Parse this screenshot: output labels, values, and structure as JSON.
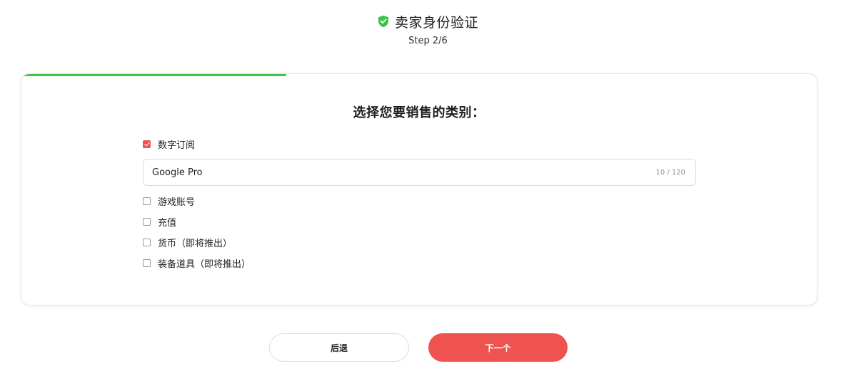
{
  "header": {
    "title": "卖家身份验证",
    "step": "Step 2/6"
  },
  "progress": {
    "current_step": 2,
    "total_steps": 6,
    "fraction": 0.333
  },
  "card": {
    "question": "选择您要销售的类别："
  },
  "options": [
    {
      "label": "数字订阅",
      "checked": true
    },
    {
      "label": "游戏账号",
      "checked": false
    },
    {
      "label": "充值",
      "checked": false
    },
    {
      "label": "货币（即将推出）",
      "checked": false
    },
    {
      "label": "装备道具（即将推出）",
      "checked": false
    }
  ],
  "subscription_input": {
    "value": "Google Pro",
    "char_count": "10 / 120"
  },
  "buttons": {
    "back_label": "后退",
    "next_label": "下一个"
  },
  "colors": {
    "accent": "#ef5350",
    "progress": "#45c24a",
    "shield": "#3cc34a"
  },
  "icons": {
    "title_icon": "shield-check-icon",
    "checkbox_checked": "check-icon"
  }
}
